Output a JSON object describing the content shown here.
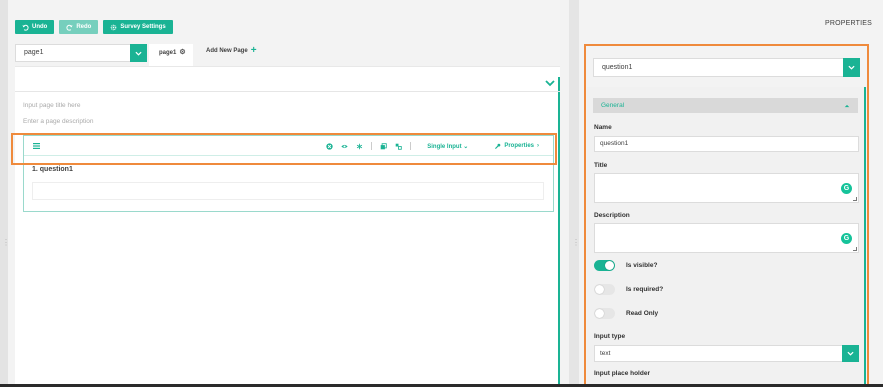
{
  "toolbar": {
    "undo_label": "Undo",
    "redo_label": "Redo",
    "survey_settings_label": "Survey Settings"
  },
  "pages": {
    "selected_page": "page1",
    "active_tab": "page1",
    "add_page_label": "Add New Page"
  },
  "page": {
    "title_placeholder": "Input page title here",
    "description_placeholder": "Enter a page description"
  },
  "question": {
    "title": "1. question1",
    "type_label": "Single Input",
    "properties_label": "Properties"
  },
  "properties": {
    "header": "PROPERTIES",
    "selected_object": "question1",
    "group_general": "General",
    "name_label": "Name",
    "name_value": "question1",
    "title_label": "Title",
    "description_label": "Description",
    "is_visible_label": "Is visible?",
    "is_visible": true,
    "is_required_label": "Is required?",
    "is_required": false,
    "read_only_label": "Read Only",
    "read_only": false,
    "input_type_label": "Input type",
    "input_type_value": "text",
    "placeholder_label": "Input place holder"
  },
  "colors": {
    "accent": "#1ab394",
    "highlight_outline": "#ef8a3c"
  }
}
